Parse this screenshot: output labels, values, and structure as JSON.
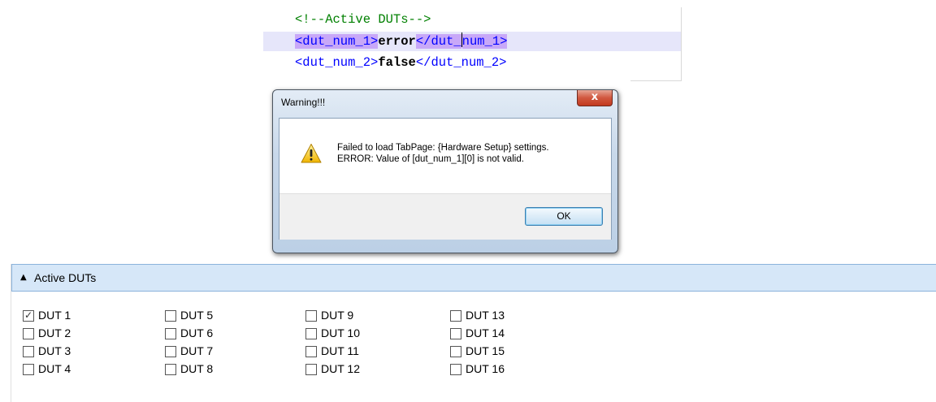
{
  "code": {
    "comment": "<!--Active DUTs-->",
    "line1": {
      "open": "<dut_num_1>",
      "value": "error",
      "close_a": "</dut_",
      "close_b": "num_1>"
    },
    "line2": {
      "open": "<dut_num_2>",
      "value": "false",
      "close": "</dut_num_2>"
    }
  },
  "dialog": {
    "title": "Warning!!!",
    "close_label": "x",
    "icon": "warning-icon",
    "message_line1": "Failed to load TabPage: {Hardware Setup} settings.",
    "message_line2": "ERROR: Value of [dut_num_1][0] is not valid.",
    "ok_label": "OK"
  },
  "group": {
    "title": "Active DUTs",
    "collapse_icon": "triangle-up-icon",
    "duts": [
      {
        "label": "DUT 1",
        "checked": true
      },
      {
        "label": "DUT 2",
        "checked": false
      },
      {
        "label": "DUT 3",
        "checked": false
      },
      {
        "label": "DUT 4",
        "checked": false
      },
      {
        "label": "DUT 5",
        "checked": false
      },
      {
        "label": "DUT 6",
        "checked": false
      },
      {
        "label": "DUT 7",
        "checked": false
      },
      {
        "label": "DUT 8",
        "checked": false
      },
      {
        "label": "DUT 9",
        "checked": false
      },
      {
        "label": "DUT 10",
        "checked": false
      },
      {
        "label": "DUT 11",
        "checked": false
      },
      {
        "label": "DUT 12",
        "checked": false
      },
      {
        "label": "DUT 13",
        "checked": false
      },
      {
        "label": "DUT 14",
        "checked": false
      },
      {
        "label": "DUT 15",
        "checked": false
      },
      {
        "label": "DUT 16",
        "checked": false
      }
    ]
  }
}
